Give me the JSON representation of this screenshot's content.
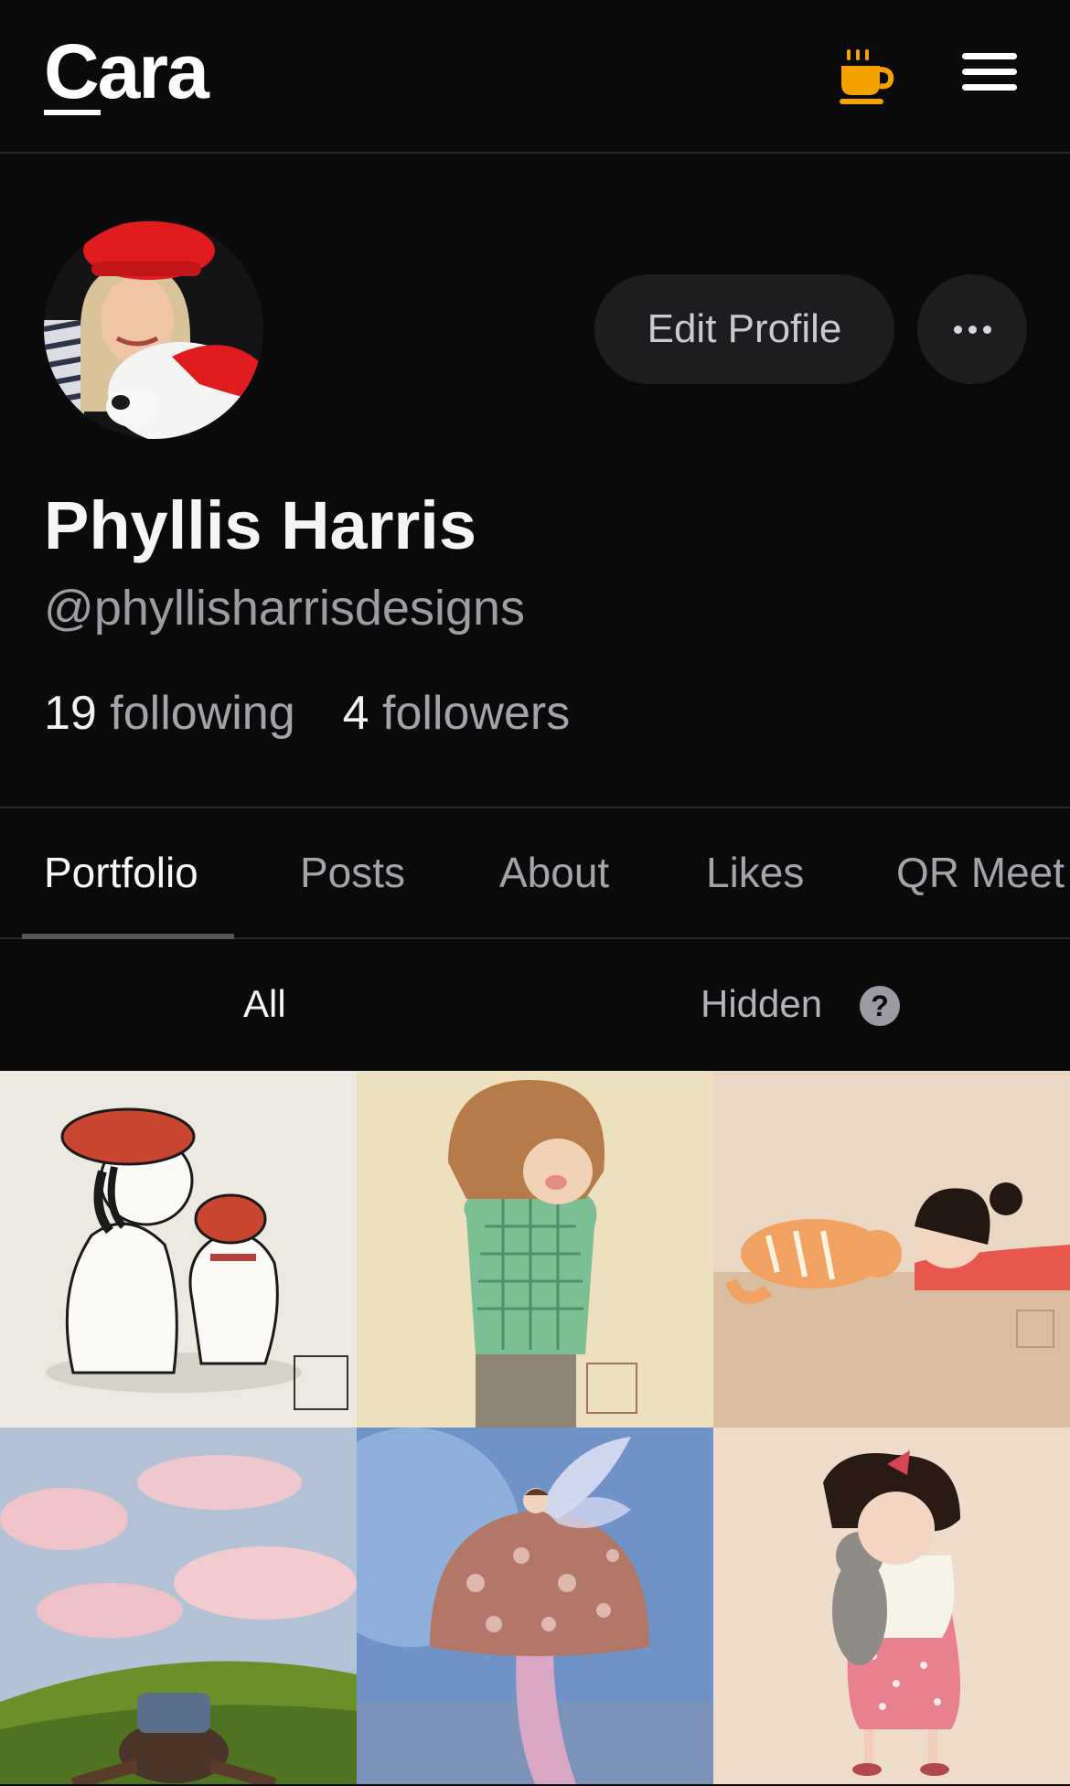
{
  "header": {
    "logo": "Cara",
    "coffee_icon": "coffee-cup-icon",
    "menu_icon": "hamburger-menu-icon",
    "accent": "#f5a100"
  },
  "profile": {
    "name": "Phyllis Harris",
    "handle": "@phyllisharrisdesigns",
    "following_count": "19",
    "following_label": "following",
    "followers_count": "4",
    "followers_label": "followers",
    "edit_label": "Edit Profile",
    "more_icon": "ellipsis-icon"
  },
  "tabs": [
    {
      "label": "Portfolio",
      "active": true
    },
    {
      "label": "Posts"
    },
    {
      "label": "About"
    },
    {
      "label": "Likes"
    },
    {
      "label": "QR Meet"
    }
  ],
  "filters": {
    "all": "All",
    "hidden": "Hidden",
    "help": "?"
  },
  "portfolio": [
    {
      "subject": "girl-and-dog-in-red-berets"
    },
    {
      "subject": "child-in-green-plaid-shirt"
    },
    {
      "subject": "girl-and-orange-cat"
    },
    {
      "subject": "girl-lying-on-grass-clouds"
    },
    {
      "subject": "fairy-on-mushroom"
    },
    {
      "subject": "girl-hugging-cat"
    }
  ]
}
